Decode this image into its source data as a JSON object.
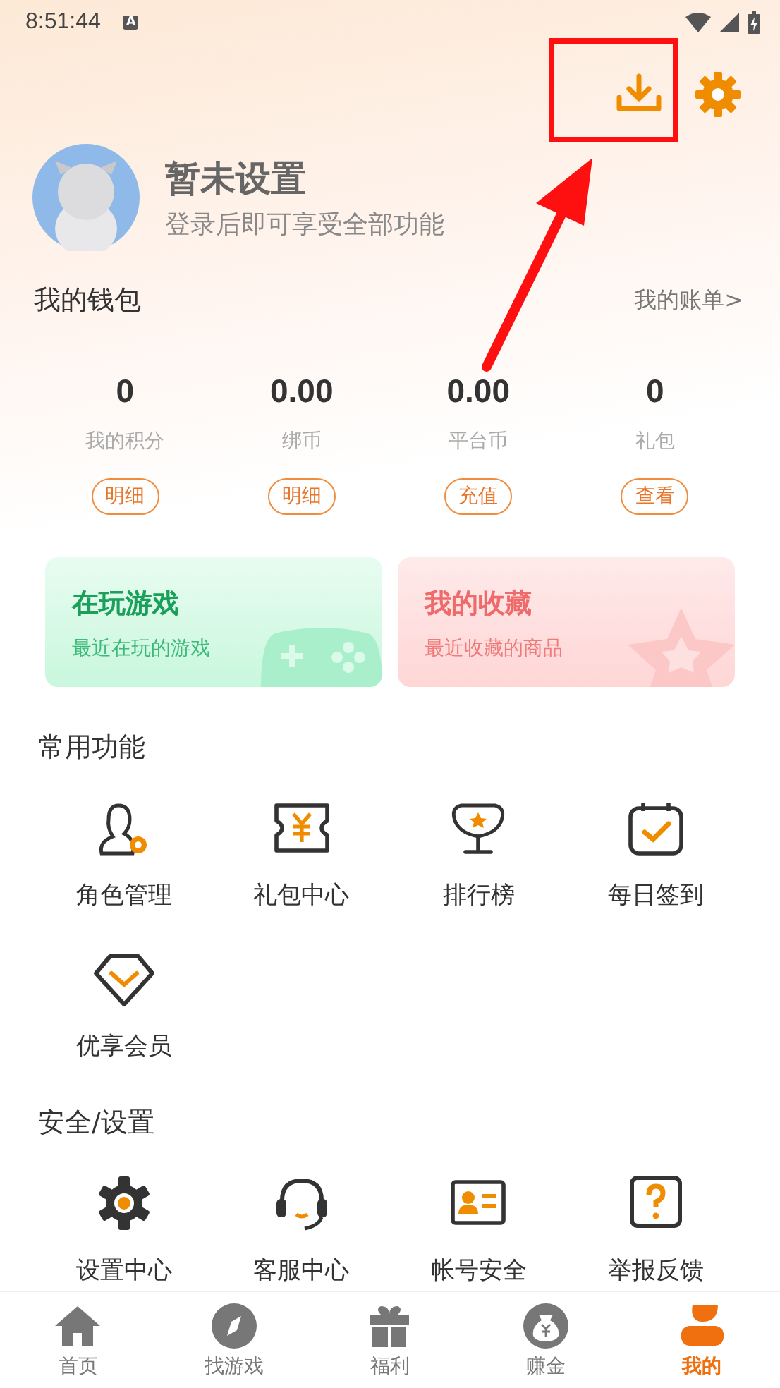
{
  "status_bar": {
    "time": "8:51:44",
    "notification": "A"
  },
  "profile": {
    "name": "暂未设置",
    "subtitle": "登录后即可享受全部功能"
  },
  "wallet": {
    "title": "我的钱包",
    "link": "我的账单>",
    "stats": [
      {
        "value": "0",
        "label": "我的积分",
        "action": "明细"
      },
      {
        "value": "0.00",
        "label": "绑币",
        "action": "明细"
      },
      {
        "value": "0.00",
        "label": "平台币",
        "action": "充值"
      },
      {
        "value": "0",
        "label": "礼包",
        "action": "查看"
      }
    ]
  },
  "cards": [
    {
      "kind": "games",
      "title": "在玩游戏",
      "subtitle": "最近在玩的游戏"
    },
    {
      "kind": "favorites",
      "title": "我的收藏",
      "subtitle": "最近收藏的商品"
    }
  ],
  "sections": [
    {
      "title": "常用功能",
      "items": [
        {
          "label": "角色管理"
        },
        {
          "label": "礼包中心"
        },
        {
          "label": "排行榜"
        },
        {
          "label": "每日签到"
        },
        {
          "label": "优享会员"
        }
      ]
    },
    {
      "title": "安全/设置",
      "items": [
        {
          "label": "设置中心"
        },
        {
          "label": "客服中心"
        },
        {
          "label": "帐号安全"
        },
        {
          "label": "举报反馈"
        }
      ]
    }
  ],
  "nav": [
    {
      "label": "首页",
      "selected": false
    },
    {
      "label": "找游戏",
      "selected": false
    },
    {
      "label": "福利",
      "selected": false
    },
    {
      "label": "赚金",
      "selected": false
    },
    {
      "label": "我的",
      "selected": true
    }
  ]
}
